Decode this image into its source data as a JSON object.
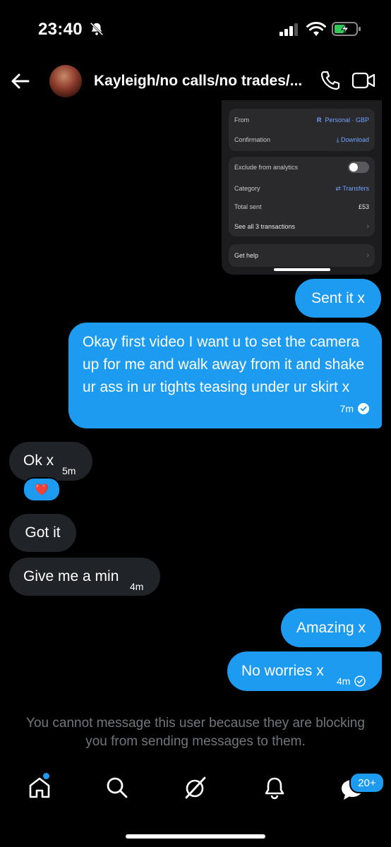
{
  "status_bar": {
    "time": "23:40"
  },
  "header": {
    "title": "Kayleigh/no calls/no trades/..."
  },
  "embedded_card": {
    "from_label": "From",
    "from_value": "Personal · GBP",
    "from_icon_letter": "R",
    "confirmation_label": "Confirmation",
    "confirmation_value": "Download",
    "exclude_label": "Exclude from analytics",
    "category_label": "Category",
    "category_value": "Transfers",
    "total_label": "Total sent",
    "total_value": "£53",
    "see_all_label": "See all 3 transactions",
    "help_label": "Get help"
  },
  "messages": [
    {
      "direction": "out",
      "text": "Sent it x"
    },
    {
      "direction": "out",
      "text": "Okay first video I want u to set the camera up for me and walk away from it and shake ur ass in ur tights teasing under ur skirt x",
      "time": "7m"
    },
    {
      "direction": "in",
      "text": "Ok x",
      "time": "5m"
    },
    {
      "direction": "in",
      "text": "Got it"
    },
    {
      "direction": "in",
      "text": "Give me a min",
      "time": "4m"
    },
    {
      "direction": "out",
      "text": "Amazing x"
    },
    {
      "direction": "out",
      "text": "No worries x",
      "time": "4m"
    }
  ],
  "reaction": "❤️",
  "notice": "You cannot message this user because they are blocking you from sending messages to them.",
  "nav": {
    "messages_badge": "20+"
  },
  "colors": {
    "accent": "#1d9bf0",
    "incoming_bubble": "#202327",
    "muted_text": "#71767b"
  }
}
